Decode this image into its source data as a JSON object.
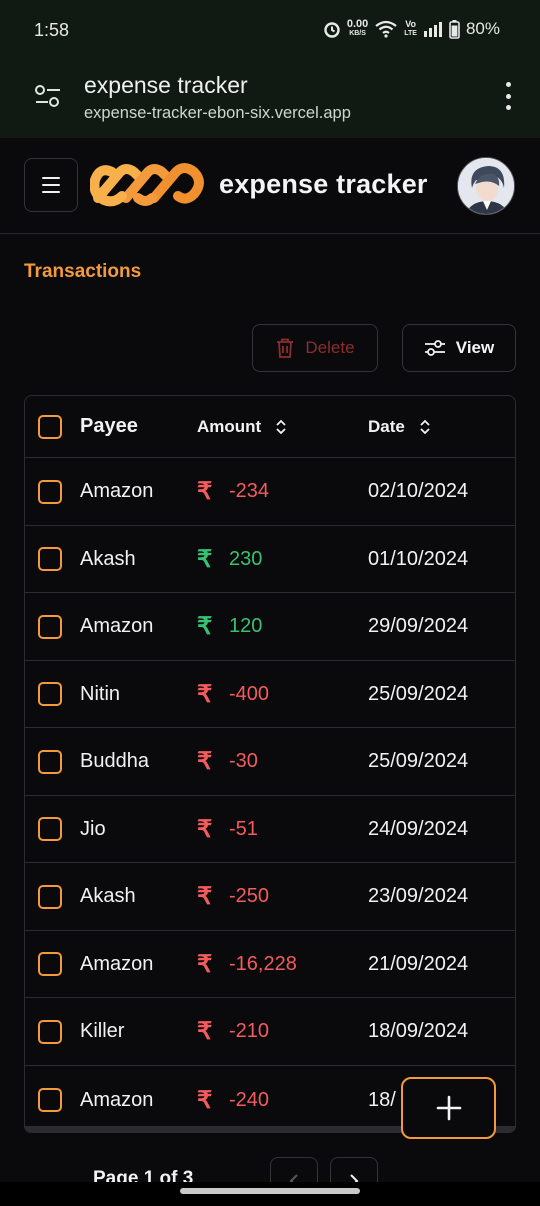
{
  "status_bar": {
    "time": "1:58",
    "net_speed": "0.00",
    "net_unit": "KB/S",
    "volte_top": "Vo",
    "volte_bottom": "LTE",
    "battery": "80%"
  },
  "browser": {
    "page_title": "expense tracker",
    "url": "expense-tracker-ebon-six.vercel.app"
  },
  "header": {
    "brand": "expense tracker"
  },
  "transactions": {
    "title": "Transactions",
    "delete_label": "Delete",
    "view_label": "View",
    "columns": {
      "payee": "Payee",
      "amount": "Amount",
      "date": "Date"
    },
    "currency_symbol": "₹",
    "rows": [
      {
        "payee": "Amazon",
        "amount": "-234",
        "date": "02/10/2024"
      },
      {
        "payee": "Akash",
        "amount": "230",
        "date": "01/10/2024"
      },
      {
        "payee": "Amazon",
        "amount": "120",
        "date": "29/09/2024"
      },
      {
        "payee": "Nitin",
        "amount": "-400",
        "date": "25/09/2024"
      },
      {
        "payee": "Buddha",
        "amount": "-30",
        "date": "25/09/2024"
      },
      {
        "payee": "Jio",
        "amount": "-51",
        "date": "24/09/2024"
      },
      {
        "payee": "Akash",
        "amount": "-250",
        "date": "23/09/2024"
      },
      {
        "payee": "Amazon",
        "amount": "-16,228",
        "date": "21/09/2024"
      },
      {
        "payee": "Killer",
        "amount": "-210",
        "date": "18/09/2024"
      },
      {
        "payee": "Amazon",
        "amount": "-240",
        "date": "18/"
      }
    ],
    "pagination": "Page 1 of 3"
  },
  "colors": {
    "accent": "#f39a3c",
    "negative": "#f25c5c",
    "positive": "#38c172",
    "background": "#0a090c",
    "delete_text": "#8a2e2e"
  },
  "icons": [
    "sliders-icon",
    "more-vertical-icon",
    "hamburger-menu-icon",
    "infinity-logo",
    "trash-icon",
    "filter-icon",
    "sort-icon",
    "plus-icon",
    "chevron-left-icon",
    "chevron-right-icon"
  ]
}
